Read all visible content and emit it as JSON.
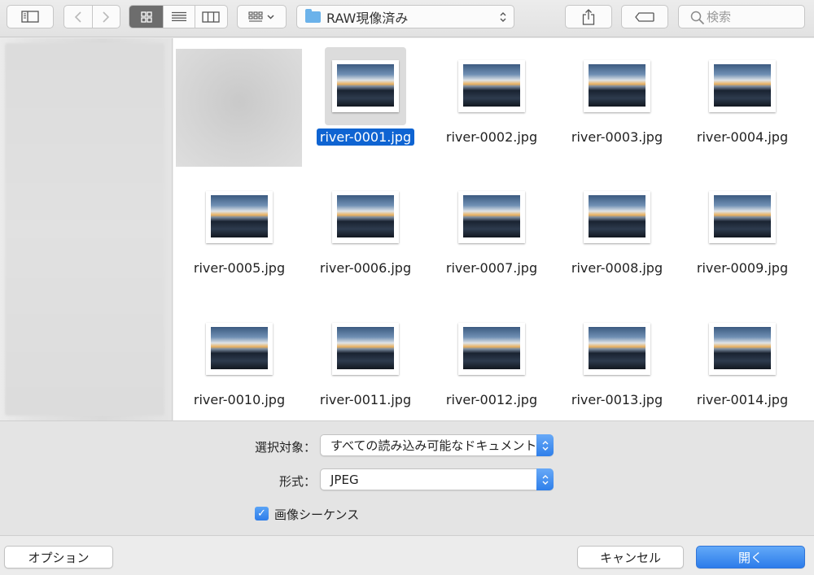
{
  "toolbar": {
    "sidebar_icon": "sidebar-icon",
    "back_icon": "chevron-left-icon",
    "forward_icon": "chevron-right-icon",
    "view_modes": [
      "icon-view-icon",
      "list-view-icon",
      "column-view-icon"
    ],
    "group_icon": "group-by-icon",
    "path": "RAW現像済み",
    "share_icon": "share-icon",
    "tag_icon": "tag-icon",
    "search_placeholder": "検索"
  },
  "files": [
    {
      "name": "river-0001.jpg",
      "selected": true
    },
    {
      "name": "river-0002.jpg"
    },
    {
      "name": "river-0003.jpg"
    },
    {
      "name": "river-0004.jpg"
    },
    {
      "name": "river-0005.jpg"
    },
    {
      "name": "river-0006.jpg"
    },
    {
      "name": "river-0007.jpg"
    },
    {
      "name": "river-0008.jpg"
    },
    {
      "name": "river-0009.jpg"
    },
    {
      "name": "river-0010.jpg"
    },
    {
      "name": "river-0011.jpg"
    },
    {
      "name": "river-0012.jpg"
    },
    {
      "name": "river-0013.jpg"
    },
    {
      "name": "river-0014.jpg"
    }
  ],
  "options": {
    "enable_label": "選択対象：",
    "enable_value": "すべての読み込み可能なドキュメント",
    "format_label": "形式：",
    "format_value": "JPEG",
    "sequence_label": "画像シーケンス",
    "sequence_checked": true
  },
  "buttons": {
    "options": "オプション",
    "cancel": "キャンセル",
    "open": "開く"
  },
  "colors": {
    "accent": "#2f7fea",
    "selection": "#0f64d2"
  }
}
